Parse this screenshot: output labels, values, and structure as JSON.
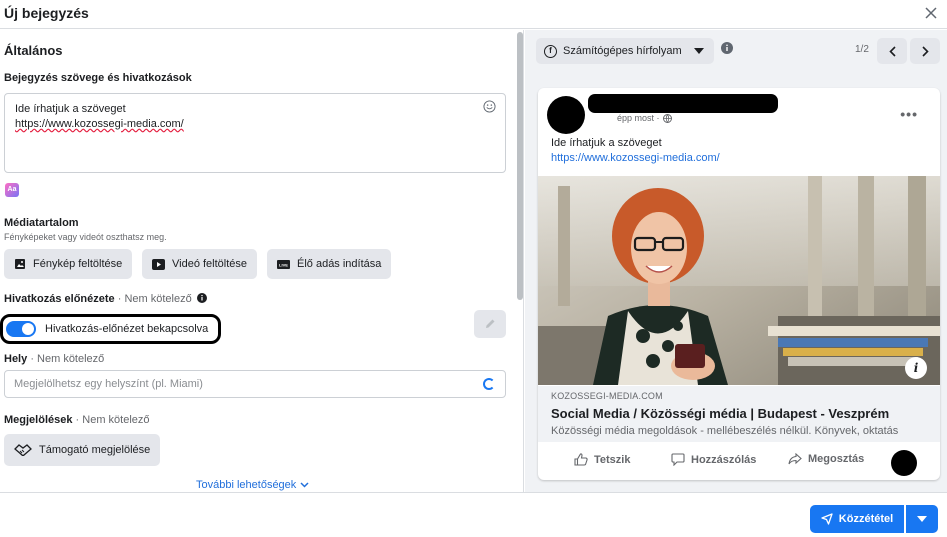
{
  "dialog": {
    "title": "Új bejegyzés"
  },
  "general": {
    "section_title": "Általános",
    "text_label": "Bejegyzés szövege és hivatkozások",
    "text_line1": "Ide írhatjuk a szöveget",
    "text_line2": "https://www.kozossegi-media.com/"
  },
  "media": {
    "label": "Médiatartalom",
    "sublabel": "Fényképeket vagy videót oszthatsz meg.",
    "photo_button": "Fénykép feltöltése",
    "video_button": "Videó feltöltése",
    "live_button": "Élő adás indítása"
  },
  "link_preview": {
    "label": "Hivatkozás előnézete",
    "optional": "· Nem kötelező",
    "toggle_label": "Hivatkozás-előnézet bekapcsolva",
    "toggle_on": true
  },
  "location": {
    "label": "Hely",
    "optional": "· Nem kötelező",
    "placeholder": "Megjelölhetsz egy helyszínt (pl. Miami)"
  },
  "tags": {
    "label": "Megjelölések",
    "optional": "· Nem kötelező",
    "sponsor_button": "Támogató megjelölése"
  },
  "more_options": "További lehetőségek",
  "preview": {
    "placement": "Számítógépes hírfolyam",
    "pager": "1/2",
    "post_time": "épp most ·",
    "post_text": "Ide írhatjuk a szöveget",
    "post_link": "https://www.kozossegi-media.com/",
    "link_domain": "KOZOSSEGI-MEDIA.COM",
    "link_title": "Social Media / Közösségi média | Budapest - Veszprém",
    "link_desc": "Közösségi média megoldások - mellébeszélés nélkül. Könyvek, oktatás",
    "actions": {
      "like": "Tetszik",
      "comment": "Hozzászólás",
      "share": "Megosztás"
    }
  },
  "footer": {
    "publish_button": "Közzététel"
  },
  "colors": {
    "accent": "#1877f2",
    "link": "#216fdb",
    "muted": "#65676b"
  }
}
